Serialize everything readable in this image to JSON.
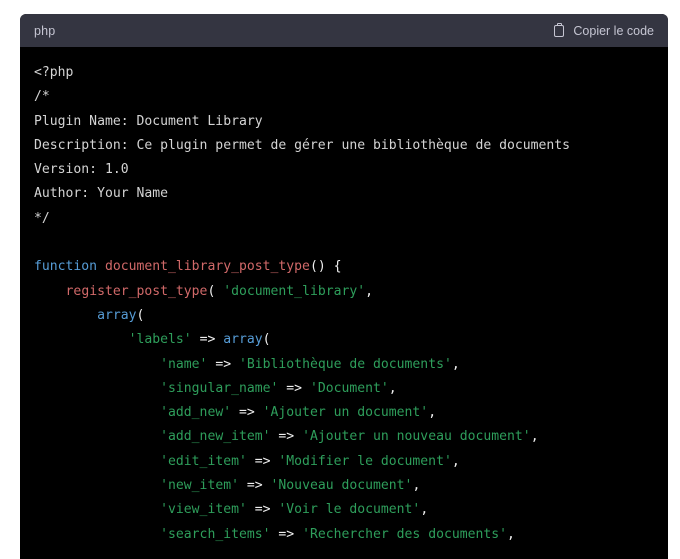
{
  "code_block": {
    "language_label": "php",
    "copy_button_label": "Copier le code",
    "copy_icon": "clipboard-icon",
    "colors": {
      "header_background": "#343541",
      "code_background": "#000000",
      "page_background": "#ffffff",
      "header_text": "#c5c5d2",
      "comment": "#d4d4d4",
      "keyword": "#569cd6",
      "function": "#d16969",
      "string": "#2e9e5b",
      "punctuation": "#f0f0f0"
    },
    "lines": [
      {
        "id": "line-1",
        "indent": 0,
        "tokens": [
          {
            "t": "tag",
            "v": "<?php"
          }
        ]
      },
      {
        "id": "line-2",
        "indent": 0,
        "tokens": [
          {
            "t": "comment",
            "v": "/*"
          }
        ]
      },
      {
        "id": "line-3",
        "indent": 0,
        "tokens": [
          {
            "t": "comment",
            "v": "Plugin Name: Document Library"
          }
        ]
      },
      {
        "id": "line-4",
        "indent": 0,
        "tokens": [
          {
            "t": "comment",
            "v": "Description: Ce plugin permet de gérer une bibliothèque de documents"
          }
        ]
      },
      {
        "id": "line-5",
        "indent": 0,
        "tokens": [
          {
            "t": "comment",
            "v": "Version: 1.0"
          }
        ]
      },
      {
        "id": "line-6",
        "indent": 0,
        "tokens": [
          {
            "t": "comment",
            "v": "Author: Your Name"
          }
        ]
      },
      {
        "id": "line-7",
        "indent": 0,
        "tokens": [
          {
            "t": "comment",
            "v": "*/"
          }
        ]
      },
      {
        "id": "line-8",
        "indent": 0,
        "tokens": []
      },
      {
        "id": "line-9",
        "indent": 0,
        "tokens": [
          {
            "t": "keyword",
            "v": "function"
          },
          {
            "t": "punct",
            "v": " "
          },
          {
            "t": "function",
            "v": "document_library_post_type"
          },
          {
            "t": "punct",
            "v": "() {"
          }
        ]
      },
      {
        "id": "line-10",
        "indent": 1,
        "tokens": [
          {
            "t": "function",
            "v": "register_post_type"
          },
          {
            "t": "punct",
            "v": "( "
          },
          {
            "t": "string",
            "v": "'document_library'"
          },
          {
            "t": "punct",
            "v": ","
          }
        ]
      },
      {
        "id": "line-11",
        "indent": 2,
        "tokens": [
          {
            "t": "builtin",
            "v": "array"
          },
          {
            "t": "punct",
            "v": "("
          }
        ]
      },
      {
        "id": "line-12",
        "indent": 3,
        "tokens": [
          {
            "t": "string",
            "v": "'labels'"
          },
          {
            "t": "op",
            "v": " => "
          },
          {
            "t": "builtin",
            "v": "array"
          },
          {
            "t": "punct",
            "v": "("
          }
        ]
      },
      {
        "id": "line-13",
        "indent": 4,
        "tokens": [
          {
            "t": "string",
            "v": "'name'"
          },
          {
            "t": "op",
            "v": " => "
          },
          {
            "t": "string",
            "v": "'Bibliothèque de documents'"
          },
          {
            "t": "punct",
            "v": ","
          }
        ]
      },
      {
        "id": "line-14",
        "indent": 4,
        "tokens": [
          {
            "t": "string",
            "v": "'singular_name'"
          },
          {
            "t": "op",
            "v": " => "
          },
          {
            "t": "string",
            "v": "'Document'"
          },
          {
            "t": "punct",
            "v": ","
          }
        ]
      },
      {
        "id": "line-15",
        "indent": 4,
        "tokens": [
          {
            "t": "string",
            "v": "'add_new'"
          },
          {
            "t": "op",
            "v": " => "
          },
          {
            "t": "string",
            "v": "'Ajouter un document'"
          },
          {
            "t": "punct",
            "v": ","
          }
        ]
      },
      {
        "id": "line-16",
        "indent": 4,
        "tokens": [
          {
            "t": "string",
            "v": "'add_new_item'"
          },
          {
            "t": "op",
            "v": " => "
          },
          {
            "t": "string",
            "v": "'Ajouter un nouveau document'"
          },
          {
            "t": "punct",
            "v": ","
          }
        ]
      },
      {
        "id": "line-17",
        "indent": 4,
        "tokens": [
          {
            "t": "string",
            "v": "'edit_item'"
          },
          {
            "t": "op",
            "v": " => "
          },
          {
            "t": "string",
            "v": "'Modifier le document'"
          },
          {
            "t": "punct",
            "v": ","
          }
        ]
      },
      {
        "id": "line-18",
        "indent": 4,
        "tokens": [
          {
            "t": "string",
            "v": "'new_item'"
          },
          {
            "t": "op",
            "v": " => "
          },
          {
            "t": "string",
            "v": "'Nouveau document'"
          },
          {
            "t": "punct",
            "v": ","
          }
        ]
      },
      {
        "id": "line-19",
        "indent": 4,
        "tokens": [
          {
            "t": "string",
            "v": "'view_item'"
          },
          {
            "t": "op",
            "v": " => "
          },
          {
            "t": "string",
            "v": "'Voir le document'"
          },
          {
            "t": "punct",
            "v": ","
          }
        ]
      },
      {
        "id": "line-20",
        "indent": 4,
        "tokens": [
          {
            "t": "string",
            "v": "'search_items'"
          },
          {
            "t": "op",
            "v": " => "
          },
          {
            "t": "string",
            "v": "'Rechercher des documents'"
          },
          {
            "t": "punct",
            "v": ","
          }
        ]
      }
    ]
  }
}
